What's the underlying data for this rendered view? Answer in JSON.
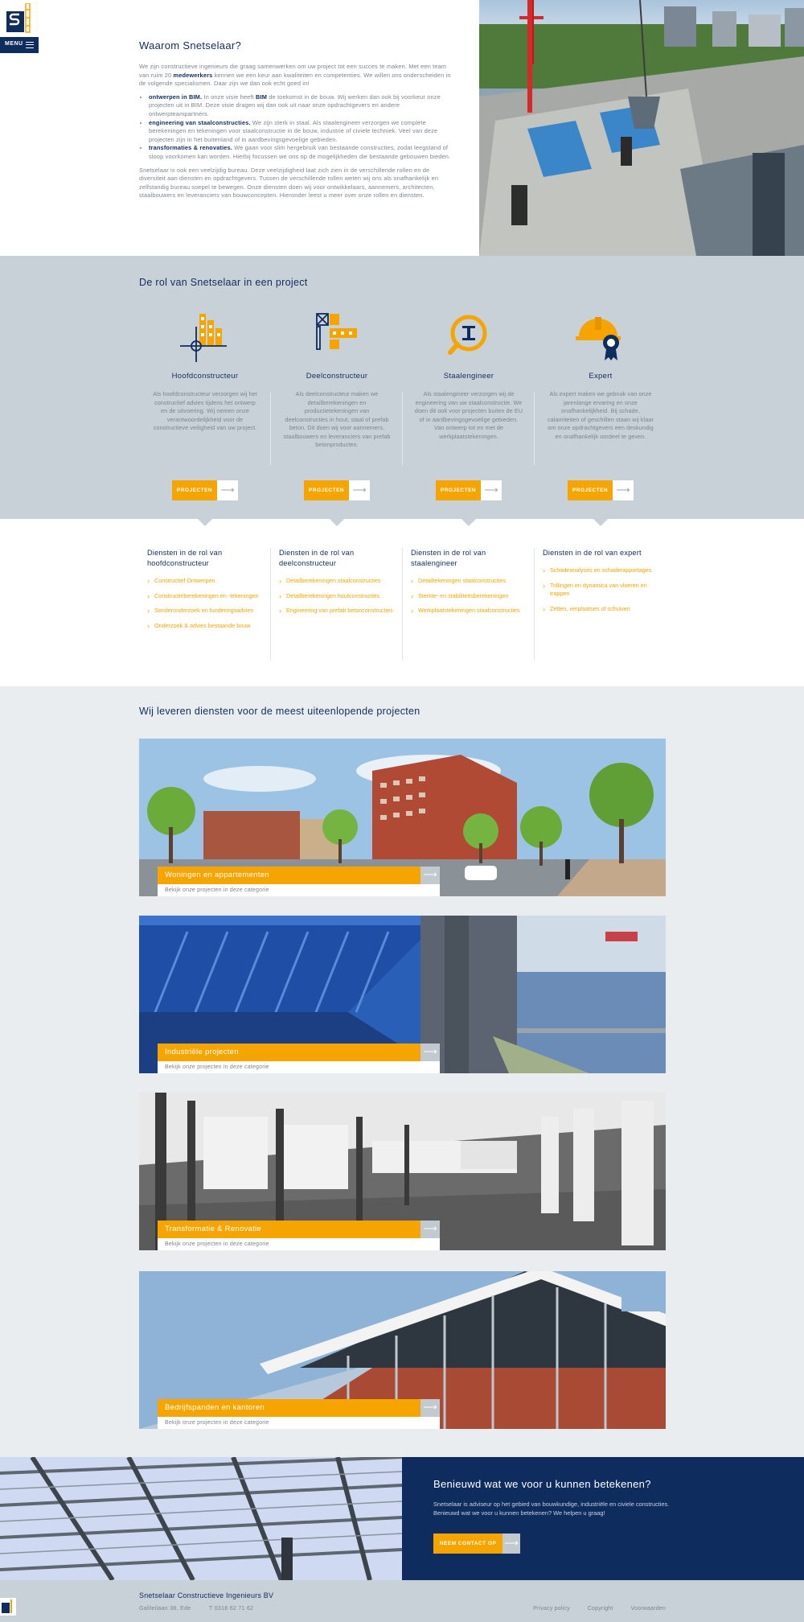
{
  "brand": {
    "navy": "#0f2c5e",
    "orange": "#f6a500",
    "grey": "#c8d1d8"
  },
  "header": {
    "logo_icon": "snetselaar-logo",
    "menu_label": "MENU",
    "menu_icon": "hamburger-icon"
  },
  "intro": {
    "title": "Waarom Snetselaar?",
    "p1_a": "We zijn constructieve ingenieurs die graag samenwerken om uw project tot een succes te maken. Met een team van ruim 20 ",
    "p1_b": "medewerkers",
    "p1_c": " kennen we een keur aan kwaliteiten en competenties. We willen ons onderscheiden in de volgende specialismen. Daar zijn we dan ook echt goed in!",
    "bullets": [
      {
        "bold": "ontwerpen in BIM.",
        "text_a": " In onze visie heeft ",
        "bold2": "BIM",
        "text_b": " de toekomst in de bouw. Wij werken dan ook bij voorkeur onze projecten uit in BIM. Deze visie dragen wij dan ook uit naar onze opdrachtgevers en andere ontwerpteampartners."
      },
      {
        "bold": "engineering van staalconstructies.",
        "text_a": " We zijn sterk in staal. Als staalengineer verzorgen we complete berekeningen en tekeningen voor staalconstructie in de bouw, industrie of civiele techniek. Veel van deze projecten zijn in het buitenland of in aardbevingsgevoelige gebieden.",
        "bold2": "",
        "text_b": ""
      },
      {
        "bold": "transformaties & renovaties.",
        "text_a": " We gaan voor slim hergebruik van bestaande constructies, zodat leegstand of sloop voorkomen kan worden. Hierbij focussen we ons op de mogelijkheden die bestaande gebouwen bieden.",
        "bold2": "",
        "text_b": ""
      }
    ],
    "p2": "Snetselaar is ook een veelzijdig bureau. Deze veelzijdigheid laat zich zien in de verschillende rollen en de diversiteit aan diensten en opdrachtgevers. Tussen de verschillende rollen weten wij ons als onafhankelijk en zelfstandig bureau soepel te bewegen. Onze diensten doen wij voor ontwikkelaars, aannemers, architecten, staalbouwers en leveranciers van bouwconcepten. Hieronder leest u meer over onze rollen en diensten."
  },
  "roles": {
    "title": "De rol van Snetselaar in een project",
    "items": [
      {
        "name": "Hoofdconstructeur",
        "icon": "building-crosshair-icon",
        "text": "Als hoofdconstructeur verzorgen wij het constructief advies tijdens het ontwerp en de uitvoering. Wij nemen onze verantwoordelijkheid voor de constructieve veiligheid van uw project.",
        "button": "PROJECTEN"
      },
      {
        "name": "Deelconstructeur",
        "icon": "construction-parts-icon",
        "text": "Als deelconstructeur maken we detailberekeningen en productietekeningen van deelconstructies in hout, staal of prefab beton. Dit doen wij voor aannemers, staalbouwers en leveranciers van prefab betonproducten.",
        "button": "PROJECTEN"
      },
      {
        "name": "Staalengineer",
        "icon": "magnifier-beam-icon",
        "text": "Als staalengineer verzorgen wij de engineering van uw staalconstructie. We doen dit ook voor projecten buiten de EU of in aardbevingsgevoelige gebieden. Van ontwerp tot en met de werkplaatstekeningen.",
        "button": "PROJECTEN"
      },
      {
        "name": "Expert",
        "icon": "helmet-award-icon",
        "text": "Als expert maken we gebruik van onze jarenlange ervaring en onze onafhankelijkheid. Bij schade, calamiteiten of geschillen staan wij klaar om onze opdrachtgevers een deskundig en onafhankelijk oordeel te geven.",
        "button": "PROJECTEN"
      }
    ]
  },
  "services": [
    {
      "title": "Diensten in de rol van hoofdconstructeur",
      "items": [
        "Constructief Ontwerpen",
        "Constructieberekeningen en -tekeningen",
        "Sonderonderzoek en funderingsadvies",
        "Onderzoek & advies bestaande bouw"
      ]
    },
    {
      "title": "Diensten in de rol van deelconstructeur",
      "items": [
        "Detailberekeningen staalconstructies",
        "Detailberekeningen houtconstructies",
        "Engineering van prefab betonconstructies"
      ]
    },
    {
      "title": "Diensten in de rol van staalengineer",
      "items": [
        "Detailtekeningen staalconstructies",
        "Sterkte- en stabiliteitsberekeningen",
        "Werkplaatstekeningen staalconstructies"
      ]
    },
    {
      "title": "Diensten in de rol van expert",
      "items": [
        "Schadeanalyses en schaderapportages",
        "Trillingen en dynamica van vloeren en trappen",
        "Zetten, verplaatsen of schuiven"
      ]
    }
  ],
  "projects": {
    "title": "Wij leveren diensten voor de meest uiteenlopende projecten",
    "items": [
      {
        "title": "Woningen en appartementen",
        "sub": "Bekijk onze projecten in deze categorie"
      },
      {
        "title": "Industriële projecten",
        "sub": "Bekijk onze projecten in deze categorie"
      },
      {
        "title": "Transformatie & Renovatie",
        "sub": "Bekijk onze projecten in deze categorie"
      },
      {
        "title": "Bedrijfspanden en kantoren",
        "sub": "Bekijk onze projecten in deze categorie"
      }
    ]
  },
  "contact": {
    "title": "Benieuwd wat we voor u kunnen betekenen?",
    "text": "Snetselaar is adviseur op het gebied van bouwkundige, industriële en civiele constructies. Benieuwd wat we voor u kunnen betekenen? We helpen u graag!",
    "button": "NEEM CONTACT OP"
  },
  "footer": {
    "company": "Snetselaar Constructieve Ingenieurs BV",
    "address": "Galileilaan 38, Ede",
    "phone": "T 0318 62 71 62",
    "links": [
      "Privacy policy",
      "Copyright",
      "Voorwaarden"
    ]
  }
}
